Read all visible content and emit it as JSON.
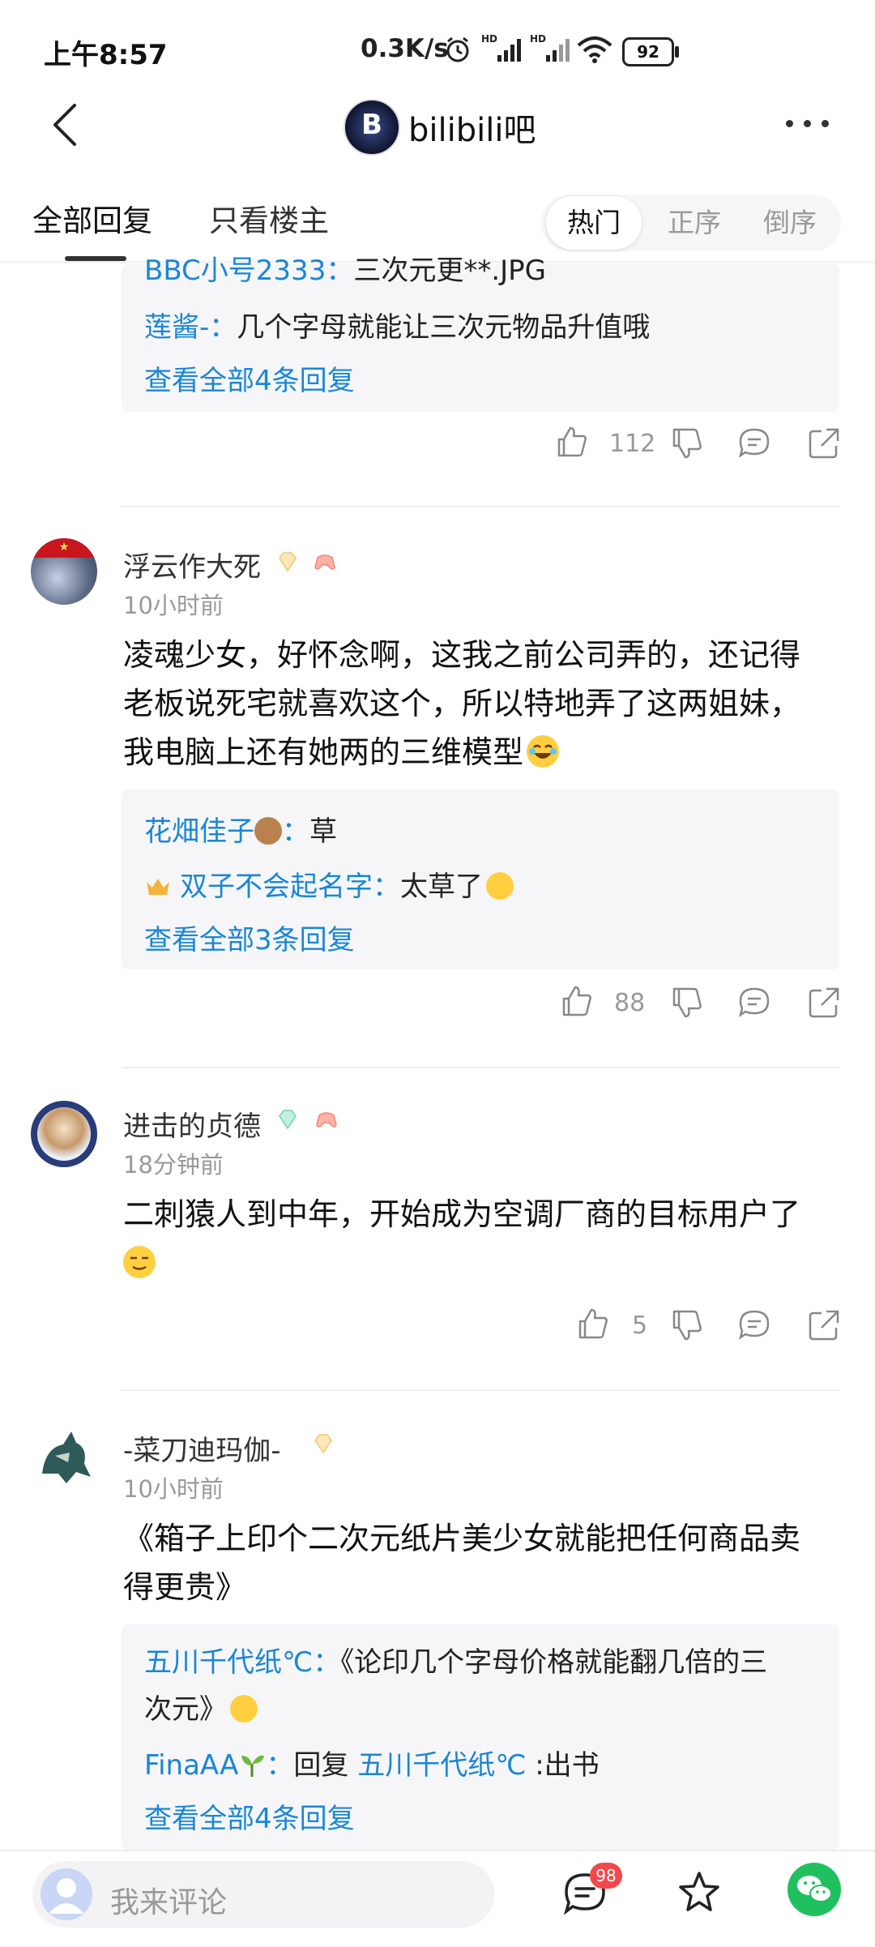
{
  "status_bar": {
    "time": "上午8:57",
    "speed": "0.3K/s",
    "battery": "92"
  },
  "header": {
    "forum_name": "bilibili吧",
    "forum_avatar_letter": "B"
  },
  "tabs": {
    "all": "全部回复",
    "owner_only": "只看楼主"
  },
  "sort": {
    "hot": "热门",
    "asc": "正序",
    "desc": "倒序"
  },
  "posts": [
    {
      "replies": [
        {
          "user": "BBC小号2333",
          "sep": "：",
          "text": "三次元更**.JPG"
        },
        {
          "user": "莲酱-",
          "sep": "：",
          "text": "几个字母就能让三次元物品升值哦"
        }
      ],
      "view_all": "查看全部4条回复",
      "likes": "112"
    },
    {
      "author": "浮云作大死",
      "time": "10小时前",
      "content_lines": [
        "凌魂少女，好怀念啊，这我之前公司弄的，还记得",
        "老板说死宅就喜欢这个，所以特地弄了这两姐妹，",
        "我电脑上还有她两的三维模型"
      ],
      "replies": [
        {
          "user": "花畑佳子",
          "sep": "：",
          "text": "草"
        },
        {
          "user": "双子不会起名字",
          "sep": "：",
          "text": "太草了"
        }
      ],
      "view_all": "查看全部3条回复",
      "likes": "88"
    },
    {
      "author": "进击的贞德",
      "time": "18分钟前",
      "content_lines": [
        "二刺猿人到中年，开始成为空调厂商的目标用户了"
      ],
      "likes": "5"
    },
    {
      "author": "-菜刀迪玛伽-",
      "time": "10小时前",
      "content_lines": [
        "《箱子上印个二次元纸片美少女就能把任何商品卖",
        "得更贵》"
      ],
      "replies": [
        {
          "user": "五川千代纸℃",
          "sep": "：",
          "text_lines": [
            "《论印几个字母价格就能翻几倍的三",
            "次元》"
          ]
        },
        {
          "user": "FinaAA",
          "sep": "：",
          "text": "回复 ",
          "user2": "五川千代纸℃",
          "text2": " :出书"
        }
      ],
      "view_all": "查看全部4条回复"
    }
  ],
  "bottom_bar": {
    "placeholder": "我来评论",
    "notification_count": "98"
  },
  "colors": {
    "link_blue": "#1a86d6",
    "muted_gray": "#999999",
    "badge_red": "#f2484b",
    "wechat_green": "#21c05f"
  }
}
